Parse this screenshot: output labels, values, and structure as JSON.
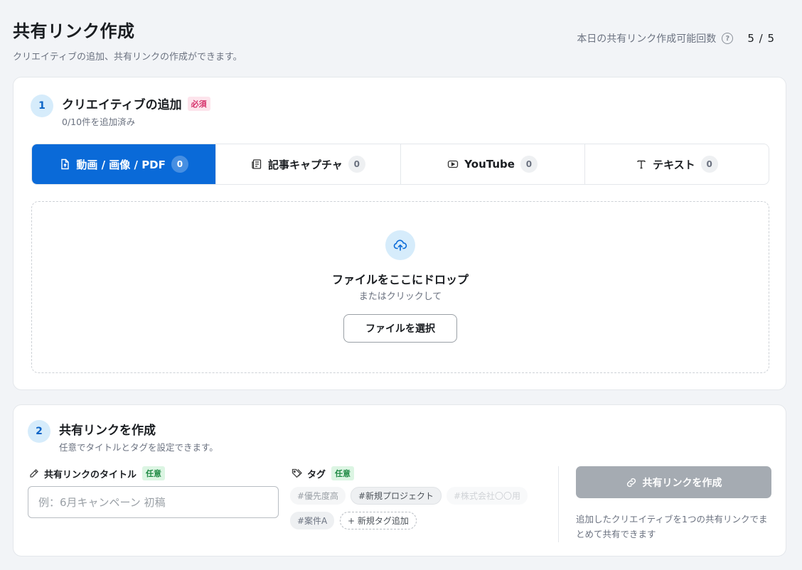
{
  "header": {
    "title": "共有リンク作成",
    "subtitle": "クリエイティブの追加、共有リンクの作成ができます。",
    "quota_label": "本日の共有リンク作成可能回数",
    "quota_help_icon": "question-circle-icon",
    "quota_value": "5 / 5"
  },
  "step1": {
    "number": "1",
    "title": "クリエイティブの追加",
    "required_badge": "必須",
    "subtitle": "0/10件を追加済み",
    "tabs": [
      {
        "label": "動画 / 画像 / PDF",
        "count": "0",
        "icon": "file-upload-icon",
        "active": true
      },
      {
        "label": "記事キャプチャ",
        "count": "0",
        "icon": "newspaper-icon",
        "active": false
      },
      {
        "label": "YouTube",
        "count": "0",
        "icon": "youtube-icon",
        "active": false
      },
      {
        "label": "テキスト",
        "count": "0",
        "icon": "text-icon",
        "active": false
      }
    ],
    "dropzone": {
      "icon": "cloud-upload-icon",
      "title": "ファイルをここにドロップ",
      "subtitle": "またはクリックして",
      "button_label": "ファイルを選択"
    }
  },
  "step2": {
    "number": "2",
    "title": "共有リンクを作成",
    "subtitle": "任意でタイトルとタグを設定できます。",
    "title_field": {
      "label": "共有リンクのタイトル",
      "badge": "任意",
      "icon": "pencil-icon",
      "placeholder": "例：6月キャンペーン 初稿",
      "value": ""
    },
    "tag_field": {
      "label": "タグ",
      "badge": "任意",
      "icon": "tag-icon",
      "tags": [
        "#優先度高",
        "#新規プロジェクト",
        "#株式会社〇〇用",
        "#案件A"
      ],
      "add_label": "+ 新規タグ追加"
    },
    "create_button": {
      "label": "共有リンクを作成",
      "icon": "link-icon"
    },
    "note": "追加したクリエイティブを1つの共有リンクでまとめて共有できます"
  },
  "colors": {
    "accent": "#0a6ad8",
    "required": "#d6336c",
    "optional": "#1f8a44",
    "disabled_button": "#a5abb2"
  }
}
